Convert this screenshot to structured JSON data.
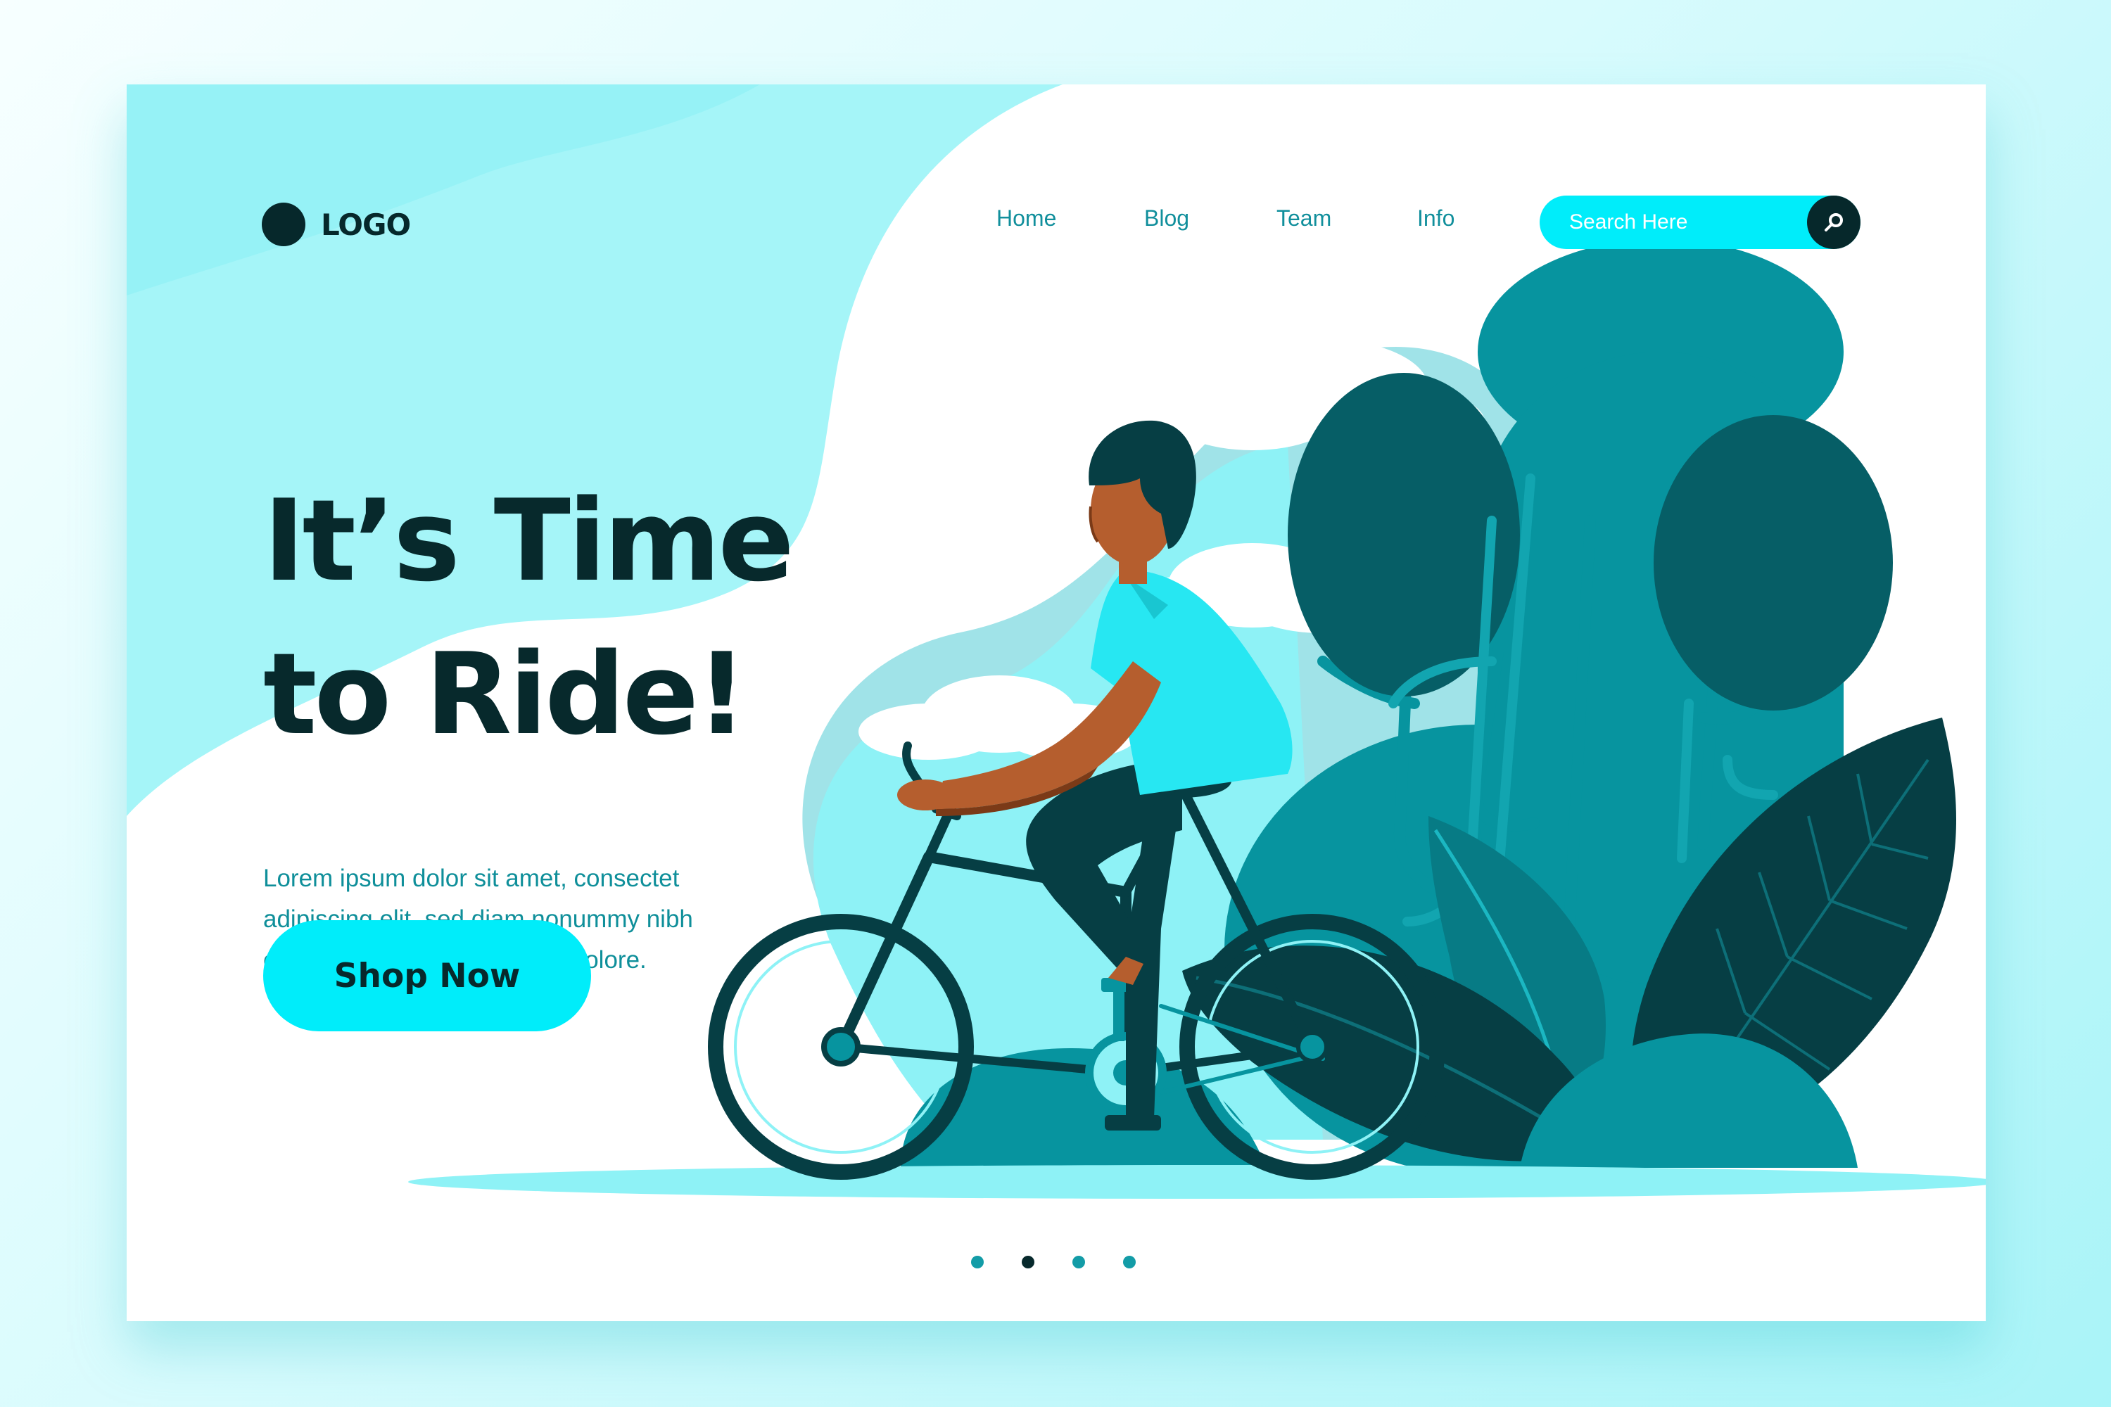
{
  "header": {
    "logo_text": "LOGO",
    "nav": [
      {
        "label": "Home"
      },
      {
        "label": "Blog"
      },
      {
        "label": "Team"
      },
      {
        "label": "Info"
      }
    ],
    "search": {
      "placeholder": "Search Here",
      "icon": "search-icon"
    }
  },
  "hero": {
    "headline_line1": "It’s Time",
    "headline_line2": "to Ride!",
    "description_line1": "Lorem ipsum dolor sit amet, consectet",
    "description_line2": "adipiscing elit, sed diam nonummy nibh",
    "description_line3": "euismod tincidunt ut laoreet dolore.",
    "cta_label": "Shop Now"
  },
  "pagination": {
    "count": 4,
    "active_index": 1
  },
  "colors": {
    "accent": "#00edfa",
    "dark": "#07292c",
    "teal": "#0f8f9a",
    "tree_dark": "#065e66",
    "tree_mid": "#07949f"
  }
}
